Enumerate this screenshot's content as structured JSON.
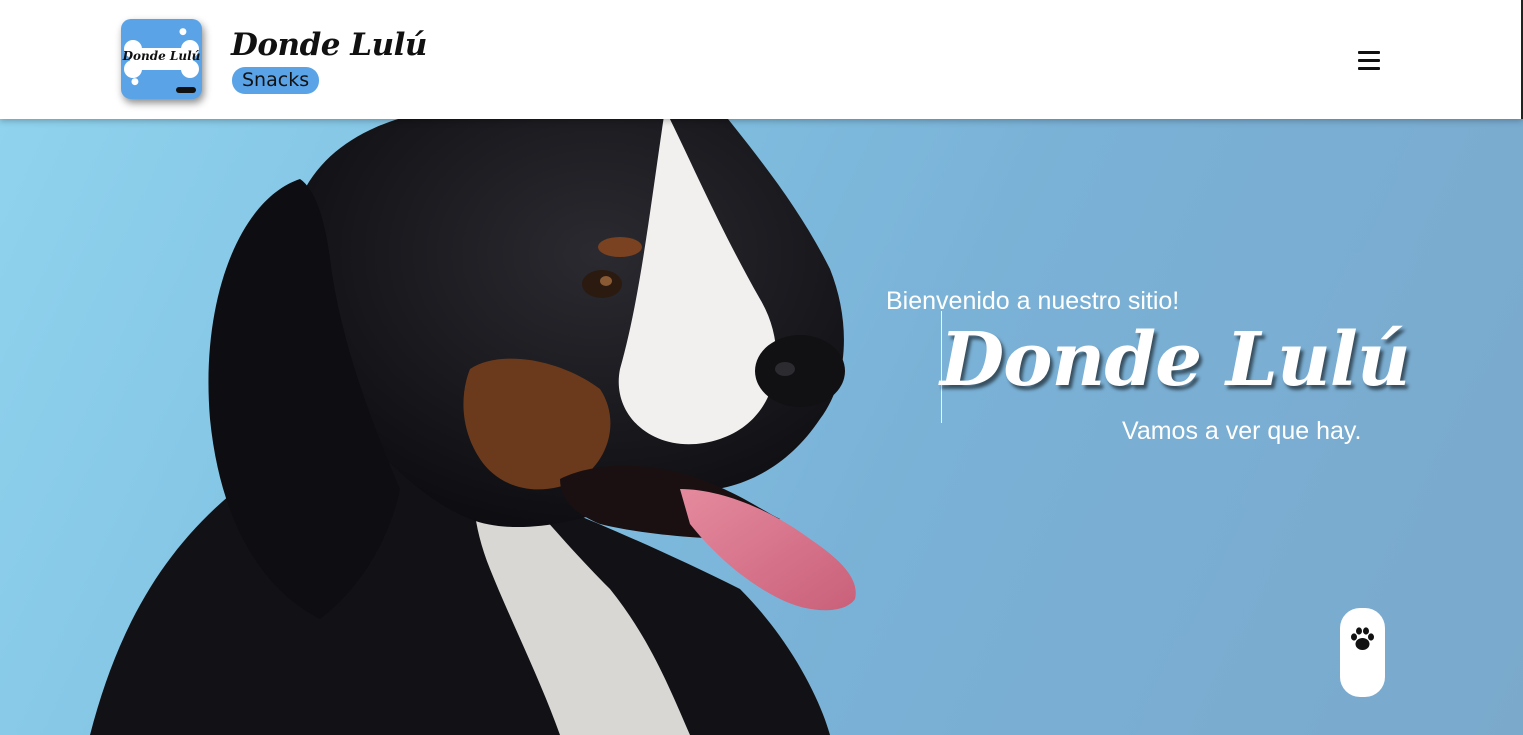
{
  "header": {
    "logo_text": "Donde Lulú",
    "brand_title": "Donde Lulú",
    "brand_subtitle": "Snacks",
    "menu_icon": "hamburger-menu-icon"
  },
  "hero": {
    "welcome": "Bienvenido a nuestro sitio!",
    "title": "Donde Lulú",
    "tagline": "Vamos a ver que hay.",
    "image": "bernese-mountain-dog-photo",
    "floating_button_icon": "paw-icon"
  },
  "colors": {
    "accent_blue": "#5aa3e6",
    "hero_bg": "#7fbfe0",
    "text_dark": "#111111",
    "text_light": "#ffffff"
  }
}
